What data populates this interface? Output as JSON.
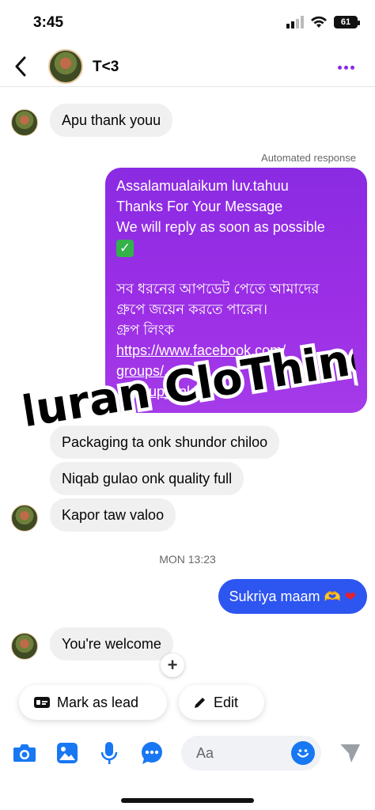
{
  "status_bar": {
    "time": "3:45",
    "battery": "61"
  },
  "header": {
    "contact_name": "T<3"
  },
  "messages": {
    "m1": "Apu thank youu",
    "automated_label": "Automated response",
    "auto_reply_lines": [
      "Assalamualaikum luv.tahuu",
      "Thanks For Your Message",
      "We will reply as soon as possible",
      "",
      "",
      "সব ধরনের আপডেট পেতে আমাদের",
      "গ্রুপে জয়েন করতে পারেন।",
      "গ্রুপ লিংক",
      "https://www.facebook.com/",
      "groups/...",
      "...group_link"
    ],
    "m2": "Packaging ta onk shundor chiloo",
    "m3": "Niqab gulao onk quality full",
    "m4": "Kapor taw valoo",
    "time_separator": "MON 13:23",
    "m5": "Sukriya maam",
    "m6": "You're welcome"
  },
  "watermark": "Nuran CloThing",
  "actions": {
    "mark_lead": "Mark as lead",
    "edit": "Edit"
  },
  "composer": {
    "placeholder": "Aa"
  },
  "colors": {
    "accent_purple": "#8a2be2",
    "sent_blue": "#2d55f0",
    "icon_blue": "#1877f2"
  }
}
